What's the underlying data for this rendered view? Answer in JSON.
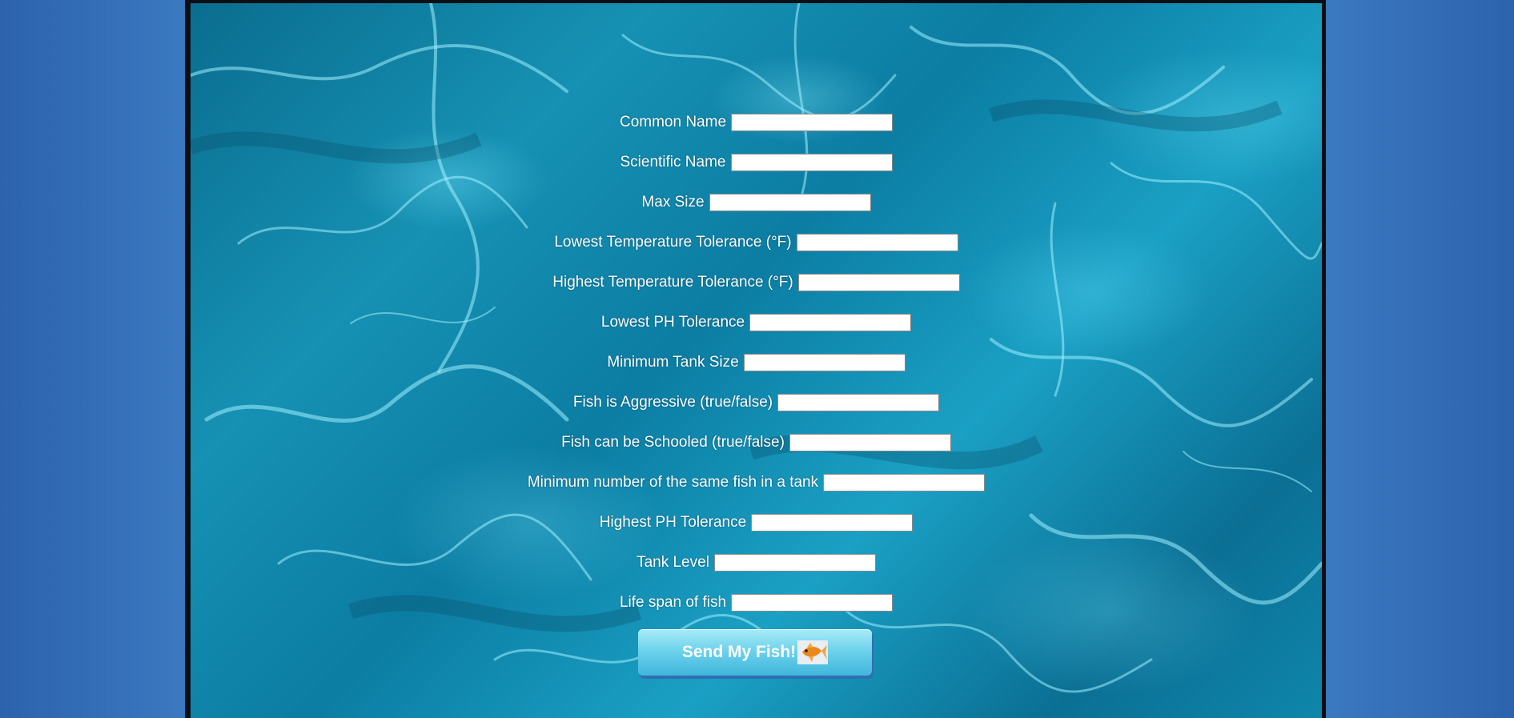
{
  "form": {
    "fields": [
      {
        "label": "Common Name",
        "value": ""
      },
      {
        "label": "Scientific Name",
        "value": ""
      },
      {
        "label": "Max Size",
        "value": ""
      },
      {
        "label": "Lowest Temperature Tolerance (°F)",
        "value": ""
      },
      {
        "label": "Highest Temperature Tolerance (°F)",
        "value": ""
      },
      {
        "label": "Lowest PH Tolerance",
        "value": ""
      },
      {
        "label": "Minimum Tank Size",
        "value": ""
      },
      {
        "label": "Fish is Aggressive (true/false)",
        "value": ""
      },
      {
        "label": "Fish can be Schooled (true/false)",
        "value": ""
      },
      {
        "label": "Minimum number of the same fish in a tank",
        "value": ""
      },
      {
        "label": "Highest PH Tolerance",
        "value": ""
      },
      {
        "label": "Tank Level",
        "value": ""
      },
      {
        "label": "Life span of fish",
        "value": ""
      }
    ],
    "submit_label": "Send My Fish!",
    "submit_icon": "goldfish-icon"
  },
  "colors": {
    "page_background": "#2c64b0",
    "water": "#0c7da3",
    "button": "#6fd2ec",
    "button_shadow": "#2f6fb2"
  }
}
